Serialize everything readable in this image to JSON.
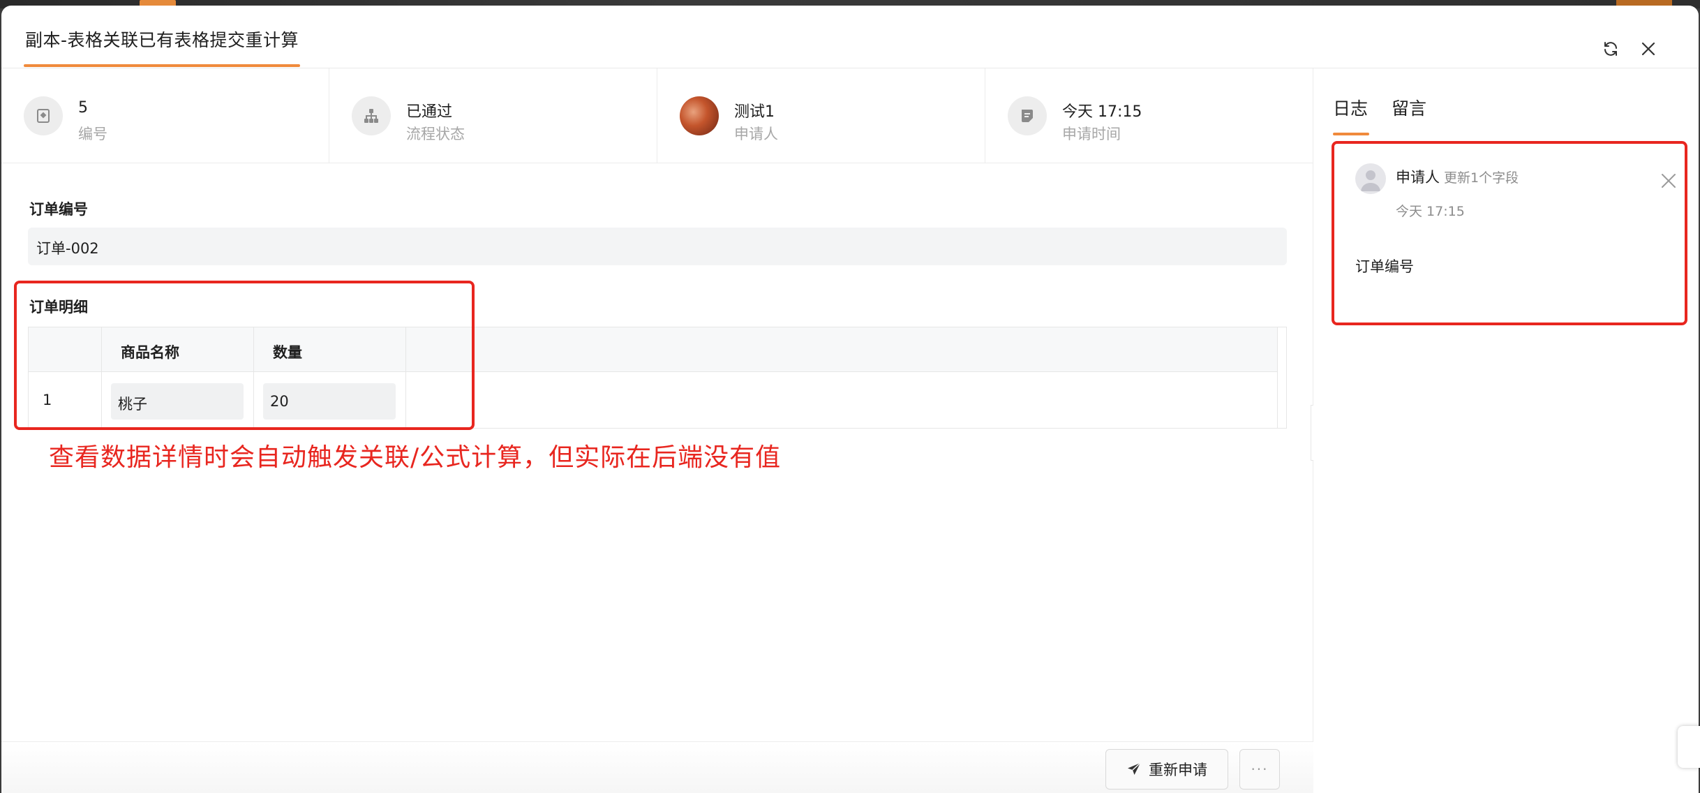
{
  "modal": {
    "title": "副本-表格关联已有表格提交重计算",
    "accent_color": "#f08a3c",
    "header_icons": [
      "refresh-icon",
      "close-icon"
    ]
  },
  "info_bar": [
    {
      "icon": "bookmark-icon",
      "value": "5",
      "label": "编号"
    },
    {
      "icon": "flowchart-icon",
      "value": "已通过",
      "label": "流程状态"
    },
    {
      "icon": "avatar",
      "value": "测试1",
      "label": "申请人"
    },
    {
      "icon": "document-icon",
      "value": "今天 17:15",
      "label": "申请时间"
    }
  ],
  "form": {
    "order_no": {
      "label": "订单编号",
      "value": "订单-002"
    },
    "order_detail": {
      "label": "订单明细",
      "columns": [
        "",
        "商品名称",
        "数量"
      ],
      "rows": [
        {
          "index": "1",
          "name": "桃子",
          "qty": "20"
        }
      ]
    }
  },
  "annotation": {
    "text": "查看数据详情时会自动触发关联/公式计算，但实际在后端没有值",
    "color": "#e8261f"
  },
  "footer": {
    "reapply_label": "重新申请",
    "more_label": "···"
  },
  "side_panel": {
    "tabs": [
      "日志",
      "留言"
    ],
    "active_tab": "日志",
    "log": {
      "user": "申请人",
      "action": "更新1个字段",
      "time": "今天 17:15",
      "field": "订单编号"
    }
  }
}
